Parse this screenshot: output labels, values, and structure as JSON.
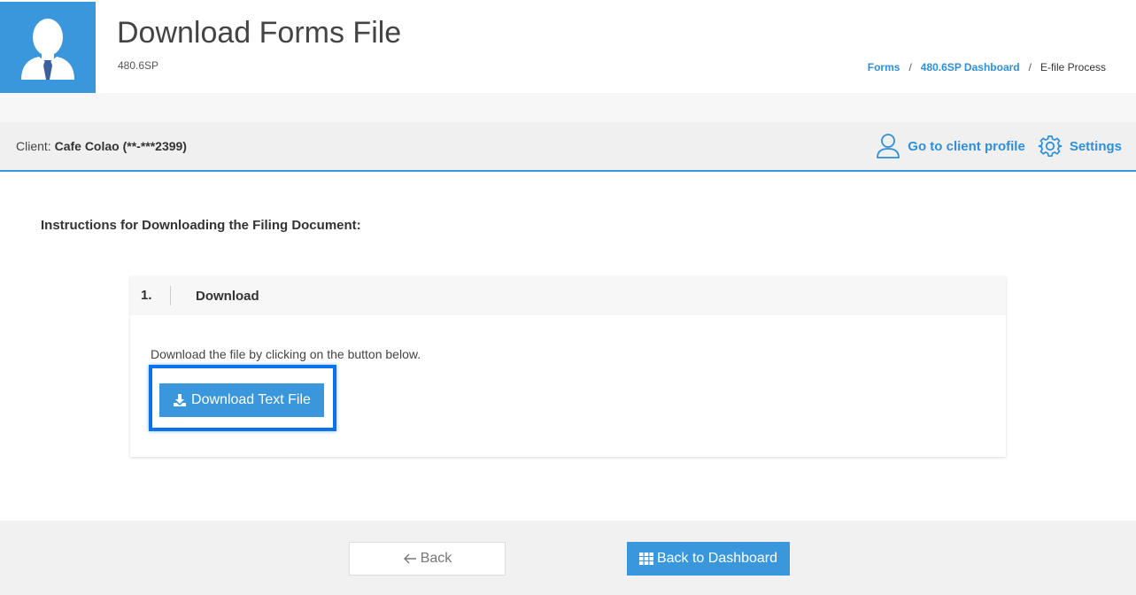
{
  "header": {
    "title": "Download Forms File",
    "subtitle": "480.6SP",
    "avatar_icon": "user-avatar-icon",
    "breadcrumb": {
      "forms": "Forms",
      "dashboard": "480.6SP Dashboard",
      "current": "E-file Process",
      "separator": "/"
    }
  },
  "client_bar": {
    "label": "Client:",
    "client_name": "Cafe Colao (**-***2399)",
    "profile_link": "Go to client profile",
    "settings_link": "Settings"
  },
  "main": {
    "instructions_title": "Instructions for Downloading the Filing Document:",
    "step": {
      "number": "1.",
      "label": "Download",
      "description": "Download the file by clicking on the button below.",
      "button_label": "Download Text File"
    }
  },
  "footer": {
    "back_label": "Back",
    "dashboard_label": "Back to Dashboard"
  },
  "colors": {
    "accent": "#3a97db",
    "highlight": "#0b73e8",
    "link": "#2f8fd8"
  }
}
